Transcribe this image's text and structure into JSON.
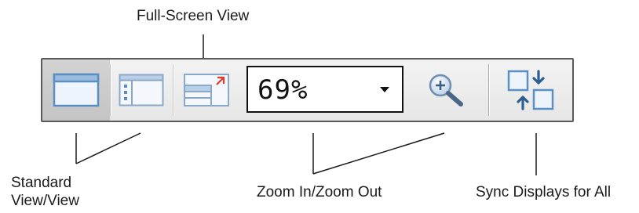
{
  "labels": {
    "full_screen_view": "Full-Screen View",
    "standard_view_line1": "Standard",
    "standard_view_line2": "View/View",
    "zoom_in_out": "Zoom In/Zoom Out",
    "sync_displays": "Sync Displays for All"
  },
  "toolbar": {
    "buttons": [
      {
        "name": "standard-view",
        "icon": "standard-view-icon",
        "selected": true
      },
      {
        "name": "view",
        "icon": "view-icon",
        "selected": false
      },
      {
        "name": "full-screen-view",
        "icon": "full-screen-view-icon",
        "selected": false
      },
      {
        "name": "zoom",
        "icon": "zoom-in-magnifier-icon",
        "selected": false
      },
      {
        "name": "sync-displays",
        "icon": "sync-displays-icon",
        "selected": false
      }
    ],
    "zoom": {
      "value": "69%",
      "caret_icon": "dropdown-caret-icon"
    }
  },
  "colors": {
    "icon_blue": "#5b8fc4",
    "icon_fill": "#eef4fb",
    "icon_header": "#9bbcdf",
    "fullscreen_arrow": "#e23b2e",
    "selected_button": "#c9c9c9",
    "toolbar_bg": "#ececec",
    "toolbar_border": "#5a5a5a"
  }
}
